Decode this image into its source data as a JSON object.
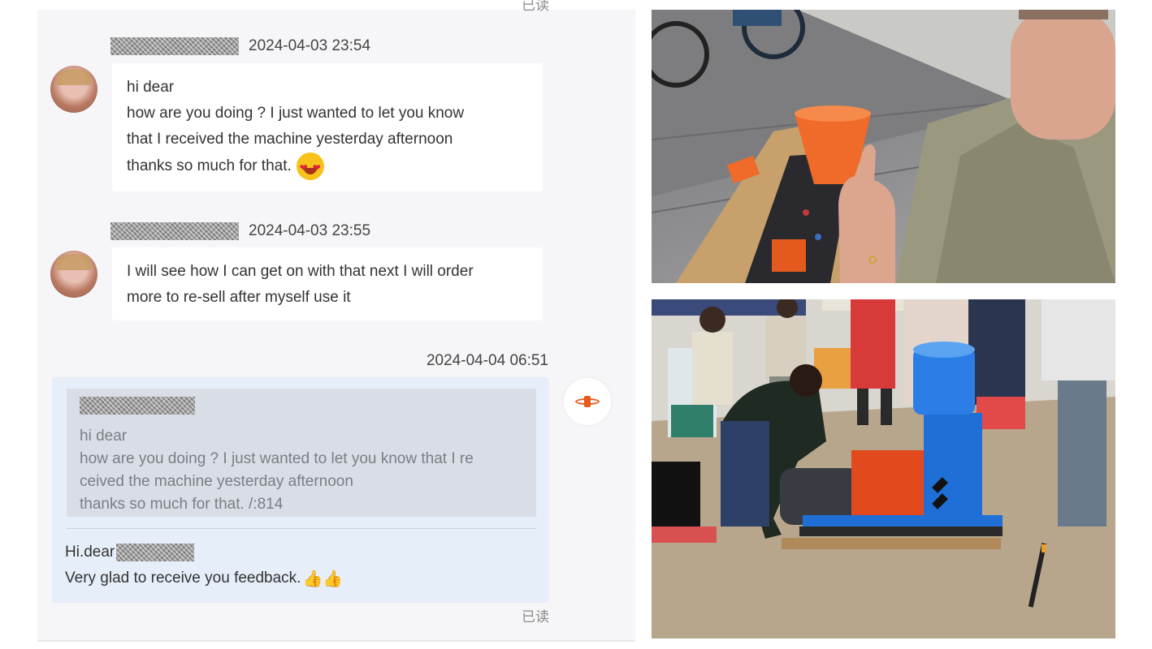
{
  "chat": {
    "read_status": "已读",
    "messages": [
      {
        "timestamp": "2024-04-03 23:54",
        "lines": [
          "hi dear",
          "how are you doing ? I just wanted to let you know",
          "that I received the machine yesterday afternoon",
          "thanks so much for that."
        ],
        "emoji": "heart-eyes-emoji"
      },
      {
        "timestamp": "2024-04-03 23:55",
        "lines": [
          "I will see how I can get on with that next I will order",
          "more to re-sell after myself use it"
        ]
      }
    ],
    "reply": {
      "timestamp": "2024-04-04 06:51",
      "quote_lines": [
        "hi dear",
        "how are you doing ? I just wanted to let you know that I re",
        "ceived the machine yesterday afternoon",
        "thanks so much for that. /:814"
      ],
      "greeting": "Hi.dear",
      "body": "Very glad to receive you feedback.",
      "emoji": "thumbs-up-emoji",
      "emoji_glyph": "👍👍"
    }
  },
  "photos": {
    "top": "customer-thumbs-up-photo",
    "bottom": "pellet-machine-unboxing-photo"
  },
  "colors": {
    "chat_bg": "#f6f6f8",
    "reply_bg": "#e6eef9",
    "quote_bg": "#d8dde6",
    "machine_blue": "#1f6fd6",
    "machine_red": "#e24a1e",
    "funnel_orange": "#f06a2a"
  }
}
